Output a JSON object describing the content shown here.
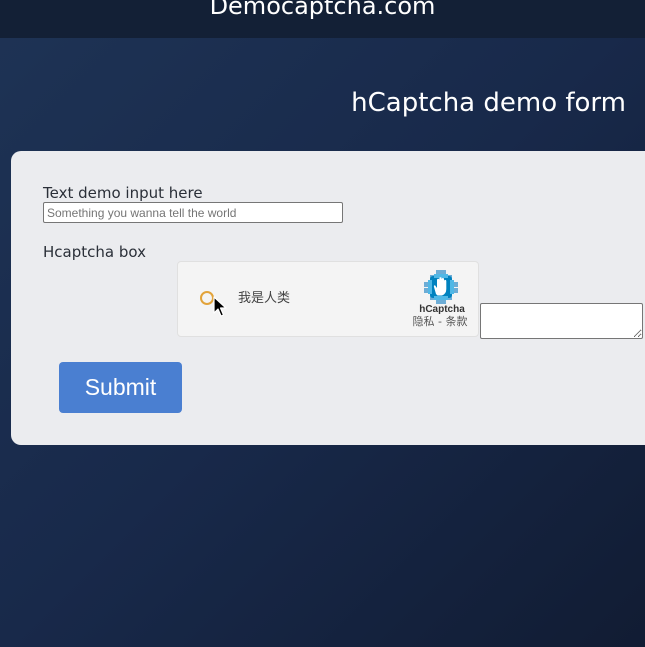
{
  "site": {
    "title": "Democaptcha.com"
  },
  "page": {
    "heading": "hCaptcha demo form"
  },
  "form": {
    "text_input_label": "Text demo input here",
    "text_input_placeholder": "Something you wanna tell the world",
    "text_input_value": "",
    "captcha_label": "Hcaptcha box",
    "submit_label": "Submit"
  },
  "captcha": {
    "checkbox_label": "我是人类",
    "brand": "hCaptcha",
    "privacy_link": "隐私",
    "separator": " - ",
    "terms_link": "条款",
    "logo_icon": "hcaptcha-hand-logo",
    "checkbox_color": "#e2a33a"
  },
  "colors": {
    "submit_button": "#4a7fd1",
    "panel": "#ebecef",
    "background": "#1a2b4a"
  }
}
